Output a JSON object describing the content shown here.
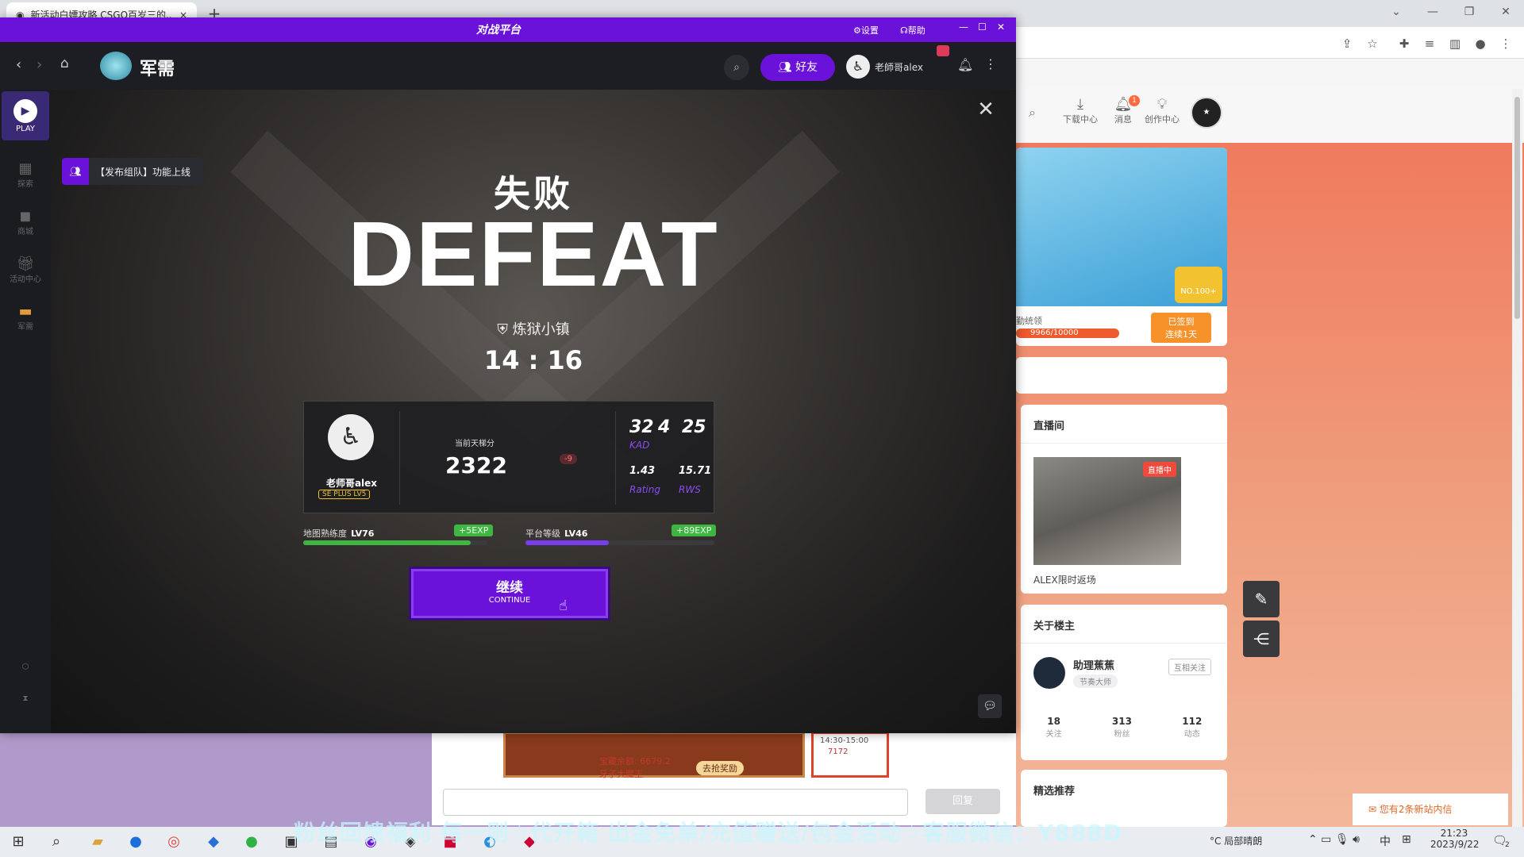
{
  "browser": {
    "tab_title": "新活动白嫖攻略 CSGO百岁三的...",
    "tab_close": "×",
    "new_tab": "+"
  },
  "site": {
    "header_icons": [
      {
        "label": "下载中心",
        "icon": "download-icon"
      },
      {
        "label": "消息",
        "icon": "bell-icon",
        "badge": "1"
      },
      {
        "label": "创作中心",
        "icon": "bulb-icon"
      }
    ],
    "banner": {
      "rank": "NO.100+",
      "progress_text": "9966/10000",
      "progress_ratio": 0.9966,
      "left_label": "勤统领",
      "checkin_line1": "已签到",
      "checkin_line2": "连续1天"
    },
    "live": {
      "title": "直播间",
      "badge": "直播中",
      "caption": "ALEX限时返场"
    },
    "about": {
      "title": "关于楼主",
      "name": "助理蕉蕉",
      "role": "节奏大师",
      "follow_btn": "互相关注",
      "stats": [
        {
          "value": "18",
          "label": "关注"
        },
        {
          "value": "313",
          "label": "粉丝"
        },
        {
          "value": "112",
          "label": "动态"
        }
      ]
    },
    "featured_title": "精选推荐",
    "reply_btn": "回复",
    "promo_text": "宝藏余额: 6679.2",
    "promo_sub": "牙子大魔王",
    "promo_cta": "去抢奖励",
    "promo_time": "14:30-15:00",
    "promo_num": "7172",
    "notice": "您有2条新站内信"
  },
  "app": {
    "titlebar": {
      "logo": "对战平台",
      "settings": "设置",
      "help": "帮助"
    },
    "navbar": {
      "section": "军需",
      "friends_btn": "好友",
      "username": "老師哥alex"
    },
    "sidebar": [
      {
        "label": "PLAY",
        "icon": "play-icon"
      },
      {
        "label": "探索",
        "icon": "grid-icon"
      },
      {
        "label": "商城",
        "icon": "bag-icon"
      },
      {
        "label": "活动中心",
        "icon": "gift-icon"
      },
      {
        "label": "军需",
        "icon": "gun-icon"
      }
    ],
    "toast": "【发布组队】功能上线",
    "result": {
      "title_cn": "失败",
      "title_en": "DEFEAT",
      "map": "炼狱小镇",
      "score": "14 : 16"
    },
    "player": {
      "name": "老师哥alex",
      "tier": "SE PLUS LV5",
      "rating_label": "当前天梯分",
      "rating": "2322",
      "rating_delta": "-9",
      "kills": "32",
      "deaths": "4",
      "assists": "25",
      "kad_label": "KAD",
      "rating_value": "1.43",
      "rating_text": "Rating",
      "rws": "15.71",
      "rws_label": "RWS"
    },
    "exp": [
      {
        "label": "地图熟练度",
        "level": "LV76",
        "gain": "+5EXP",
        "ratio": 0.91,
        "color": "#3fb542"
      },
      {
        "label": "平台等级",
        "level": "LV46",
        "gain": "+89EXP",
        "ratio": 0.44,
        "color": "#7a3cf0"
      }
    ],
    "continue_cn": "继续",
    "continue_en": "CONTINUE"
  },
  "taskbar": {
    "marquee": "粉丝回馈福利 每一则☆代开箱 出金免单/充值赠送/包金活动☆客服微信：Y888D",
    "weather": "°C 局部晴朗",
    "ime": "中",
    "time": "21:23",
    "date": "2023/9/22",
    "notif": "2"
  }
}
